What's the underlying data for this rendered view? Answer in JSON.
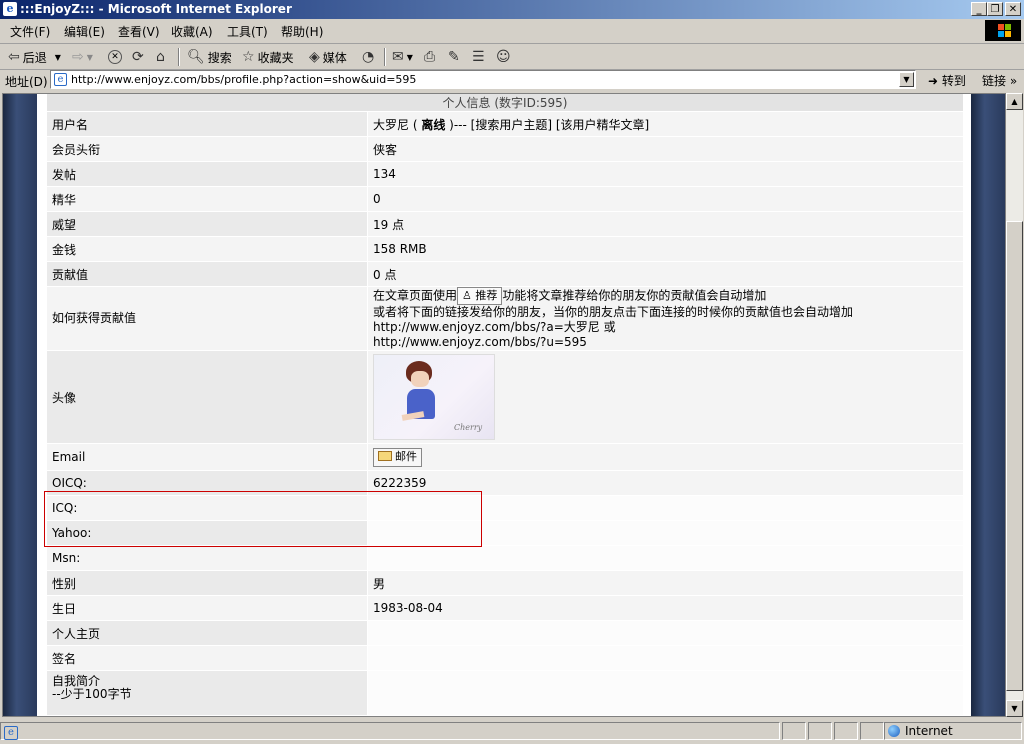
{
  "window": {
    "title": ":::EnjoyZ::: - Microsoft Internet Explorer",
    "icon": "ie-icon",
    "controls": [
      "minimize",
      "restore",
      "close"
    ]
  },
  "menu": [
    "文件(F)",
    "编辑(E)",
    "查看(V)",
    "收藏(A)",
    "工具(T)",
    "帮助(H)"
  ],
  "toolbar": {
    "back": "后退",
    "search": "搜索",
    "favorites": "收藏夹",
    "media": "媒体"
  },
  "address": {
    "label": "地址(D)",
    "url": "http://www.enjoyz.com/bbs/profile.php?action=show&uid=595",
    "go": "转到",
    "links": "链接"
  },
  "profile": {
    "header": "个人信息 (数字ID:595)",
    "rows": [
      {
        "label": "用户名",
        "value_name": "大罗尼 (",
        "value_status": "离线",
        "value_rest": ")--- [搜索用户主题] [该用户精华文章]"
      },
      {
        "label": "会员头衔",
        "value": "侠客"
      },
      {
        "label": "发帖",
        "value": "134"
      },
      {
        "label": "精华",
        "value": "0"
      },
      {
        "label": "威望",
        "value": "19 点"
      },
      {
        "label": "金钱",
        "value": "158 RMB"
      },
      {
        "label": "贡献值",
        "value": "0 点"
      }
    ],
    "how": {
      "label": "如何获得贡献值",
      "line1_pre": "在文章页面使用",
      "recommend_btn": "推荐",
      "line1_post": "功能将文章推荐给你的朋友你的贡献值会自动增加",
      "line2": "或者将下面的链接发给你的朋友，当你的朋友点击下面连接的时候你的贡献值也会自动增加",
      "link1": "http://www.enjoyz.com/bbs/?a=大罗尼 或",
      "link2": "http://www.enjoyz.com/bbs/?u=595"
    },
    "avatar_label": "头像",
    "email": {
      "label": "Email",
      "button": "邮件"
    },
    "contacts": [
      {
        "label": "OICQ:",
        "value": "6222359"
      },
      {
        "label": "ICQ:",
        "value": ""
      },
      {
        "label": "Yahoo:",
        "value": ""
      },
      {
        "label": "Msn:",
        "value": ""
      }
    ],
    "gender": {
      "label": "性别",
      "value": "男"
    },
    "birthday": {
      "label": "生日",
      "value": "1983-08-04"
    },
    "homepage": {
      "label": "个人主页",
      "value": ""
    },
    "signature": {
      "label": "签名",
      "value": ""
    },
    "intro": {
      "label": "自我简介",
      "label2": "--少于100字节"
    }
  },
  "status": {
    "zone": "Internet"
  }
}
